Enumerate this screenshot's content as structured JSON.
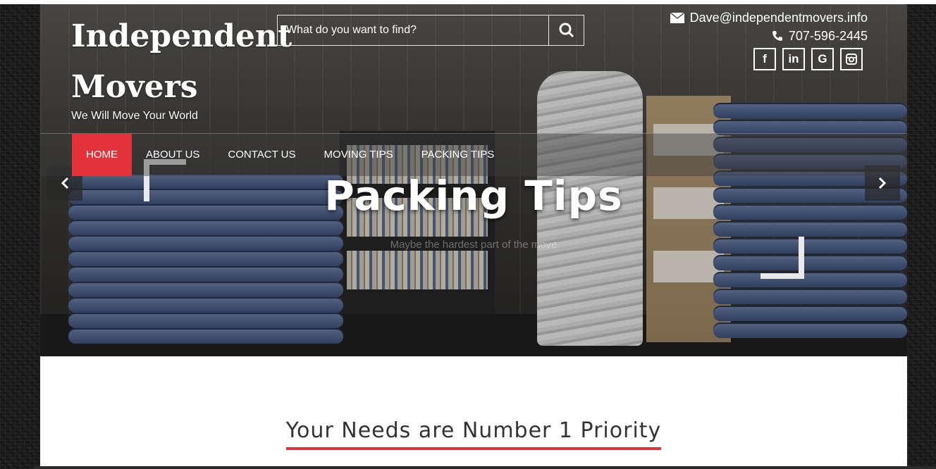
{
  "site": {
    "logo_text": "Independent Movers",
    "tagline": "We Will Move Your World"
  },
  "search": {
    "placeholder": "What do you want to find?",
    "button_icon": "search-icon"
  },
  "contact": {
    "email": "Dave@independentmovers.info",
    "phone": "707-596-2445",
    "email_icon": "envelope-icon",
    "phone_icon": "phone-icon"
  },
  "social": [
    {
      "label": "f",
      "icon": "facebook-icon"
    },
    {
      "label": "in",
      "icon": "linkedin-icon"
    },
    {
      "label": "G",
      "icon": "google-icon"
    },
    {
      "label": "◙",
      "icon": "instagram-icon"
    }
  ],
  "nav": {
    "items": [
      {
        "label": "HOME",
        "active": true
      },
      {
        "label": "ABOUT US"
      },
      {
        "label": "CONTACT US"
      },
      {
        "label": "MOVING TIPS"
      },
      {
        "label": "PACKING TIPS"
      }
    ]
  },
  "slider": {
    "title": "Packing Tips",
    "subtitle": "Maybe the hardest part of the move"
  },
  "section": {
    "heading": "Your Needs are Number 1 Priority"
  },
  "colors": {
    "accent": "#e2333a",
    "text_dark": "#333333",
    "white": "#ffffff"
  }
}
